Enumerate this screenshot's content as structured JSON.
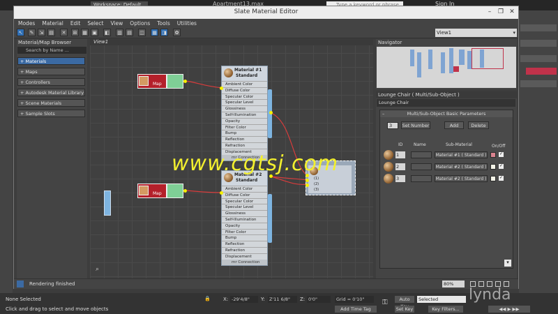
{
  "host": {
    "doc_title": "Apartment13.max",
    "workspace": "Workspace: Default",
    "search_placeholder": "Type a keyword or phrase",
    "sign_in": "Sign In"
  },
  "window": {
    "title": "Slate Material Editor",
    "minimize": "–",
    "restore": "❐",
    "close": "✕",
    "menu": [
      "Modes",
      "Material",
      "Edit",
      "Select",
      "View",
      "Options",
      "Tools",
      "Utilities"
    ],
    "view_select": "View1"
  },
  "browser": {
    "title": "Material/Map Browser",
    "search": "Search by Name ...",
    "items": [
      "+ Materials",
      "+ Maps",
      "+ Controllers",
      "+ Autodesk Material Library",
      "+ Scene Materials",
      "+ Sample Slots"
    ]
  },
  "canvas": {
    "tab": "View1",
    "map_label": "Map",
    "material1": {
      "name": "Material #1",
      "type": "Standard"
    },
    "material2": {
      "name": "Material #2",
      "type": "Standard"
    },
    "slots": [
      "Ambient Color",
      "Diffuse Color",
      "Specular Color",
      "Specular Level",
      "Glossiness",
      "Self-Illumination",
      "Opacity",
      "Filter Color",
      "Bump",
      "Reflection",
      "Refraction",
      "Displacement"
    ],
    "footer": "mr Connection",
    "multi_slots": [
      "(1)",
      "(2)",
      "(3)"
    ],
    "watermark": "www.cgtsj.com"
  },
  "navigator": {
    "title": "Navigator"
  },
  "params": {
    "header": "Lounge Chair  ( Multi/Sub-Object )",
    "name": "Lounge Chair",
    "rollout": "Multi/Sub-Object Basic Parameters",
    "count": "3",
    "set_number": "Set Number",
    "add": "Add",
    "delete": "Delete",
    "col_id": "ID",
    "col_name": "Name",
    "col_sub": "Sub-Material",
    "col_onoff": "On/Off",
    "rows": [
      {
        "id": "1",
        "material": "Material #1  ( Standard )",
        "swatch": "#d9838f"
      },
      {
        "id": "2",
        "material": "Material #2  ( Standard )",
        "swatch": "#f4f4e8"
      },
      {
        "id": "3",
        "material": "Material #2  ( Standard )",
        "swatch": "#f4f4e8"
      }
    ],
    "checked": "✓"
  },
  "status": {
    "message": "Rendering finished",
    "zoom": "80%"
  },
  "bottom": {
    "selection": "None Selected",
    "hint": "Click and drag to select and move objects",
    "x": "-29'4/8\"",
    "y": "Z'11 6/8\"",
    "z": "0'0\"",
    "grid": "Grid = 0'10\"",
    "auto_key": "Auto Key",
    "selected": "Selected",
    "set_key": "Set Key",
    "key_filters": "Key Filters...",
    "add_time_tag": "Add Time Tag",
    "brand": "lynda"
  },
  "colors": {
    "accent": "#3b6aa3",
    "connector": "#f5f000",
    "wire": "#d83c3c",
    "map_red": "#b4202a",
    "map_green": "#7fcf96"
  }
}
